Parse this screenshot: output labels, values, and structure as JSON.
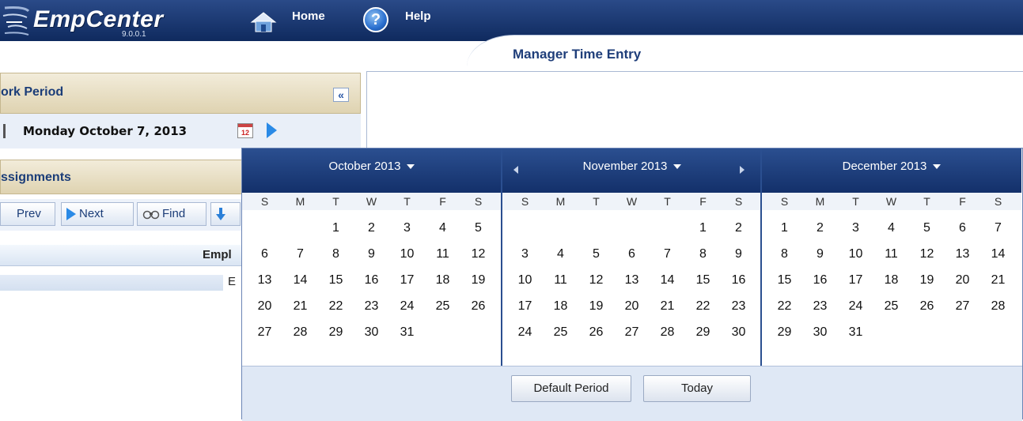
{
  "app": {
    "logo_text": "EmpCenter",
    "version": "9.0.0.1",
    "nav": {
      "home": "Home",
      "help": "Help"
    },
    "page_title": "Manager Time Entry",
    "brand_color": "#1b3d78"
  },
  "left_panel": {
    "work_period_title": "ork Period",
    "current_date": "Monday October 7, 2013",
    "calendar_icon_text": "12",
    "assignments_title": "ssignments",
    "toolbar": {
      "prev": "Prev",
      "next": "Next",
      "find": "Find"
    },
    "grid": {
      "column_header": "Empl",
      "row_value": "E"
    }
  },
  "datepicker": {
    "months": [
      {
        "title": "October 2013",
        "dows": [
          "S",
          "M",
          "T",
          "W",
          "T",
          "F",
          "S"
        ],
        "leading_blanks": 2,
        "days": [
          "1",
          "2",
          "3",
          "4",
          "5",
          "6",
          "7",
          "8",
          "9",
          "10",
          "11",
          "12",
          "13",
          "14",
          "15",
          "16",
          "17",
          "18",
          "19",
          "20",
          "21",
          "22",
          "23",
          "24",
          "25",
          "26",
          "27",
          "28",
          "29",
          "30",
          "31"
        ]
      },
      {
        "title": "November 2013",
        "dows": [
          "S",
          "M",
          "T",
          "W",
          "T",
          "F",
          "S"
        ],
        "leading_blanks": 5,
        "days": [
          "1",
          "2",
          "3",
          "4",
          "5",
          "6",
          "7",
          "8",
          "9",
          "10",
          "11",
          "12",
          "13",
          "14",
          "15",
          "16",
          "17",
          "18",
          "19",
          "20",
          "21",
          "22",
          "23",
          "24",
          "25",
          "26",
          "27",
          "28",
          "29",
          "30"
        ]
      },
      {
        "title": "December 2013",
        "dows": [
          "S",
          "M",
          "T",
          "W",
          "T",
          "F",
          "S"
        ],
        "leading_blanks": 0,
        "days": [
          "1",
          "2",
          "3",
          "4",
          "5",
          "6",
          "7",
          "8",
          "9",
          "10",
          "11",
          "12",
          "13",
          "14",
          "15",
          "16",
          "17",
          "18",
          "19",
          "20",
          "21",
          "22",
          "23",
          "24",
          "25",
          "26",
          "27",
          "28",
          "29",
          "30",
          "31"
        ]
      }
    ],
    "buttons": {
      "default_period": "Default Period",
      "today": "Today"
    }
  }
}
